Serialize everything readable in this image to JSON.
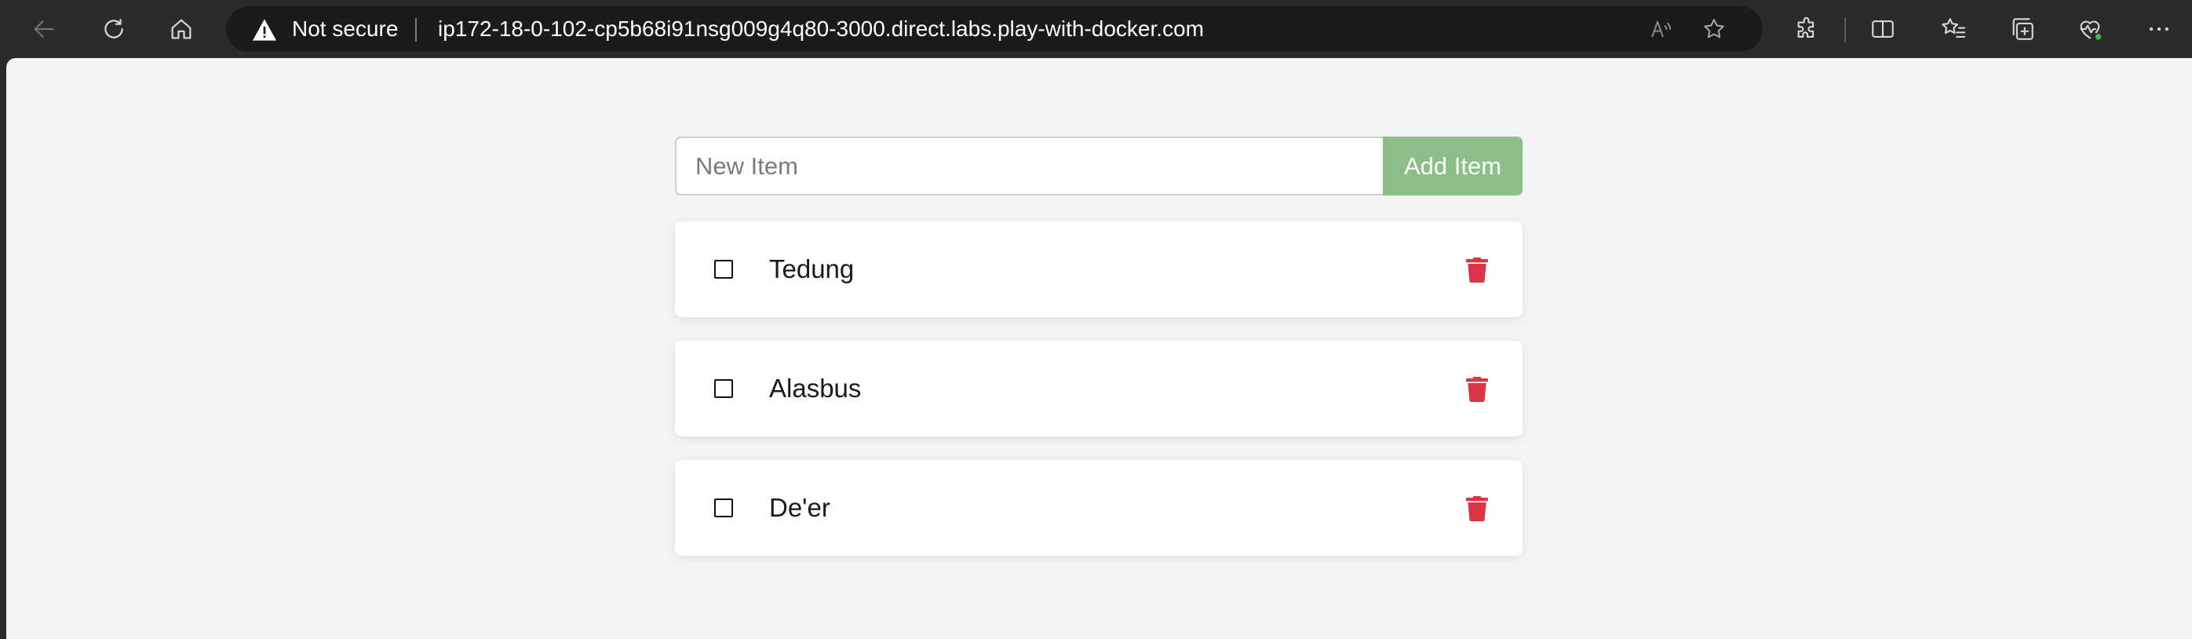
{
  "browser": {
    "security_label": "Not secure",
    "url": "ip172-18-0-102-cp5b68i91nsg009g4q80-3000.direct.labs.play-with-docker.com",
    "toolbar_icons": [
      "back-arrow-icon",
      "reload-icon",
      "home-icon",
      "read-aloud-icon",
      "favorite-star-icon",
      "extensions-icon",
      "split-screen-icon",
      "favorites-list-icon",
      "collections-icon",
      "browser-essentials-icon",
      "more-menu-icon"
    ]
  },
  "app": {
    "new_item_placeholder": "New Item",
    "add_button_label": "Add Item",
    "items": [
      {
        "name": "Tedung",
        "completed": false
      },
      {
        "name": "Alasbus",
        "completed": false
      },
      {
        "name": "De'er",
        "completed": false
      }
    ],
    "colors": {
      "add_button": "#8cbf87",
      "delete_icon": "#dc3545",
      "page_background": "#f4f4f4"
    }
  }
}
